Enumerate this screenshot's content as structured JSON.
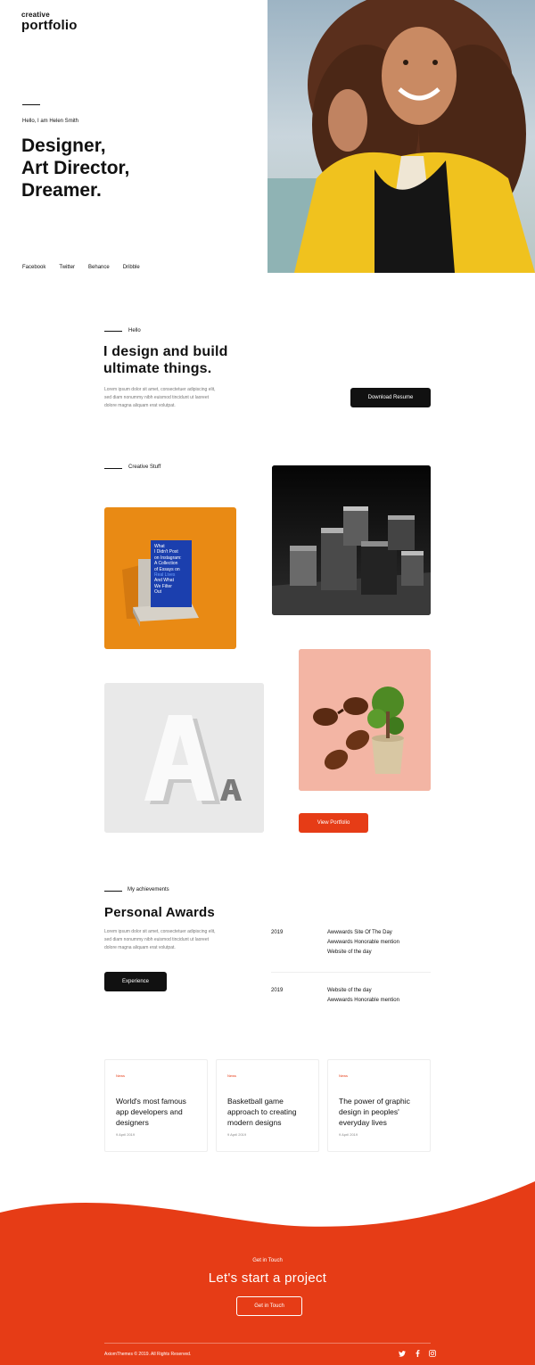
{
  "brand": {
    "line1": "creative",
    "line2": "portfolio"
  },
  "hero": {
    "greeting": "Hello, I am Helen Smith",
    "title_lines": [
      "Designer,",
      "Art Director,",
      "Dreamer."
    ],
    "socials": [
      "Facebook",
      "Twitter",
      "Behance",
      "Dribble"
    ]
  },
  "about": {
    "label": "Hello",
    "title_lines": [
      "I design and build",
      "ultimate things."
    ],
    "paragraph_lines": [
      "Lorem ipsum dolor sit amet, consectetuer adipiscing elit,",
      "sed diam nonummy nibh euismod tincidunt ut laoreet",
      "dolore magna aliquam erat volutpat."
    ],
    "button": "Download Resume"
  },
  "portfolio": {
    "label": "Creative Stuff",
    "book_text": [
      "What",
      "I Didn't Post",
      "on Instagram:",
      "A Collection",
      "of Essays on",
      "Real Lives",
      "And What",
      "We Filter",
      "Out"
    ],
    "button": "View Portfolio"
  },
  "awards": {
    "label": "My achievements",
    "title": "Personal Awards",
    "paragraph_lines": [
      "Lorem ipsum dolor sit amet, consectetuer adipiscing elit,",
      "sed diam nonummy nibh euismod tincidunt ut laoreet",
      "dolore magna aliquam erat volutpat."
    ],
    "button": "Experience",
    "items": [
      {
        "year": "2019",
        "lines": [
          "Awwwards Site Of The Day",
          "Awwwards Honorable mention",
          "Website of the day"
        ]
      },
      {
        "year": "2019",
        "lines": [
          "Website of the day",
          "Awwwards Honorable mention"
        ]
      }
    ]
  },
  "news": [
    {
      "tag": "News",
      "title_lines": [
        "World's most famous",
        "app developers and",
        "designers"
      ],
      "date": "9 April 2019"
    },
    {
      "tag": "News",
      "title_lines": [
        "Basketball game",
        "approach to creating",
        "modern designs"
      ],
      "date": "9 April 2019"
    },
    {
      "tag": "News",
      "title_lines": [
        "The power of graphic",
        "design in peoples'",
        "everyday lives"
      ],
      "date": "9 April 2019"
    }
  ],
  "contact": {
    "label": "Get in Touch",
    "title": "Let's start a project",
    "button": "Get in Touch"
  },
  "footer": {
    "copyright": "AxiomThemes © 2019. All Rights Reserved.",
    "icons": [
      "twitter-icon",
      "facebook-icon",
      "instagram-icon"
    ]
  },
  "colors": {
    "accent": "#e63c16",
    "dark": "#111111",
    "orange_tile": "#e98a14",
    "pink_tile": "#f2b3a3"
  }
}
